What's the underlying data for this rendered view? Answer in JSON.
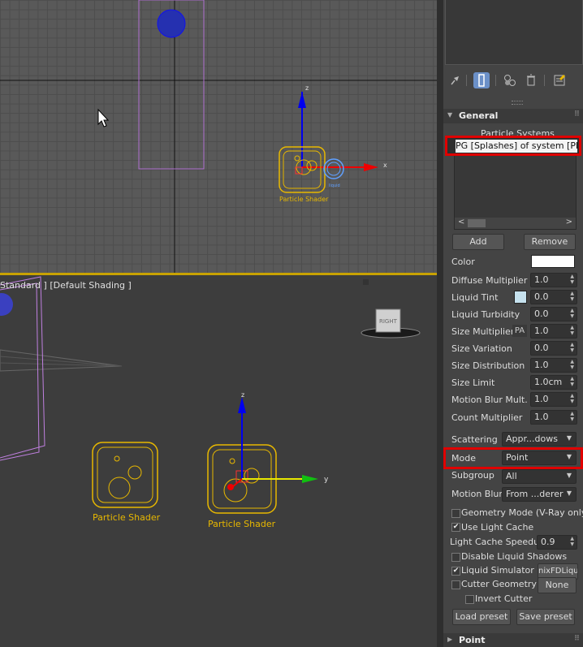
{
  "viewports": {
    "top": {
      "axis_z": "z",
      "axis_x": "x",
      "shader_label": "Particle Shader",
      "small_label": "liquid"
    },
    "perspective": {
      "label": "Standard ] [Default Shading ]",
      "cube_text": "RIGHT",
      "shader_label_1": "Particle Shader",
      "shader_label_2": "Particle Shader",
      "axis_z": "z",
      "axis_y": "y"
    }
  },
  "panel": {
    "general": {
      "title": "General",
      "particle_systems_label": "Particle Systems",
      "particle_system_item": "PG [Splashes] of system [PhoenixFD]",
      "add_label": "Add",
      "remove_label": "Remove",
      "color_label": "Color",
      "color_value": "#ffffff",
      "params": [
        {
          "label": "Diffuse Multiplier",
          "value": "1.0"
        },
        {
          "label": "Liquid Tint",
          "value": "0.0"
        },
        {
          "label": "Liquid Turbidity",
          "value": "0.0"
        },
        {
          "label": "Size Multiplier",
          "value": "1.0",
          "badge": "PA"
        },
        {
          "label": "Size Variation",
          "value": "0.0"
        },
        {
          "label": "Size Distribution",
          "value": "1.0"
        },
        {
          "label": "Size Limit",
          "value": "1.0cm"
        },
        {
          "label": "Motion Blur Mult.",
          "value": "1.0"
        },
        {
          "label": "Count Multiplier",
          "value": "1.0"
        }
      ],
      "liquid_tint_color": "#c6e2ee",
      "scattering_label": "Scattering",
      "scattering_value": "Appr...dows",
      "mode_label": "Mode",
      "mode_value": "Point",
      "subgroup_label": "Subgroup",
      "subgroup_value": "All",
      "motion_blur_label": "Motion Blur",
      "motion_blur_value": "From ...derer",
      "geometry_mode_label": "Geometry Mode (V-Ray only)",
      "use_light_cache_label": "Use Light Cache",
      "light_cache_speedup_label": "Light Cache Speedup",
      "light_cache_speedup_value": "0.9",
      "disable_liquid_shadows_label": "Disable Liquid Shadows",
      "liquid_simulator_label": "Liquid Simulator",
      "liquid_simulator_value": "nixFDLiqui",
      "cutter_geometry_label": "Cutter Geometry",
      "cutter_geometry_value": "None",
      "invert_cutter_label": "Invert Cutter",
      "load_preset_label": "Load preset",
      "save_preset_label": "Save preset",
      "geometry_mode_checked": false,
      "use_light_cache_checked": true,
      "disable_liquid_shadows_checked": false,
      "liquid_simulator_checked": true,
      "cutter_geometry_checked": false,
      "invert_cutter_checked": false
    },
    "point_section_title": "Point"
  },
  "colors": {
    "highlight": "#e00000",
    "active_viewport_border": "#c8a200",
    "particle_shader": "#e8b800",
    "active_tab": "#6b90c8"
  },
  "icons": [
    "pin-icon",
    "modify-tab-icon",
    "hierarchy-icon",
    "delete-icon",
    "configure-icon"
  ]
}
